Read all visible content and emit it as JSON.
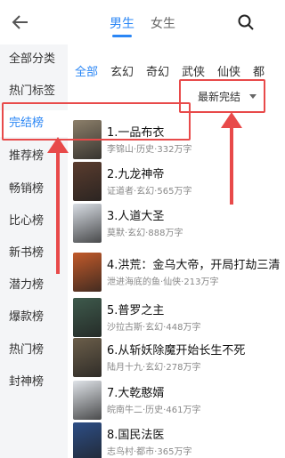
{
  "tabs": {
    "male": "男生",
    "female": "女生"
  },
  "sidebar": {
    "items": [
      {
        "label": "全部分类"
      },
      {
        "label": "热门标签"
      },
      {
        "label": "完结榜"
      },
      {
        "label": "推荐榜"
      },
      {
        "label": "畅销榜"
      },
      {
        "label": "比心榜"
      },
      {
        "label": "新书榜"
      },
      {
        "label": "潜力榜"
      },
      {
        "label": "爆款榜"
      },
      {
        "label": "热门榜"
      },
      {
        "label": "封神榜"
      }
    ]
  },
  "filters": {
    "items": [
      {
        "label": "全部"
      },
      {
        "label": "玄幻"
      },
      {
        "label": "奇幻"
      },
      {
        "label": "武侠"
      },
      {
        "label": "仙侠"
      },
      {
        "label": "都"
      }
    ]
  },
  "sort": {
    "label": "最新完结"
  },
  "books": [
    {
      "title": "1.一品布衣",
      "meta": "李锦山·历史·332万字",
      "cover": "#8c7f6a"
    },
    {
      "title": "2.九龙神帝",
      "meta": "证道者·玄幻·565万字",
      "cover": "#5a3c2e"
    },
    {
      "title": "3.人道大圣",
      "meta": "莫默·玄幻·888万字",
      "cover": "#d8dde4"
    },
    {
      "title": "4.洪荒：金乌大帝，开局打劫三清",
      "meta": "泄进海底的鱼·仙侠·213万字",
      "cover": "#c25a2a"
    },
    {
      "title": "5.普罗之主",
      "meta": "沙拉古斯·玄幻·448万字",
      "cover": "#3e5a4c"
    },
    {
      "title": "6.从斩妖除魔开始长生不死",
      "meta": "陆月十九·玄幻·278万字",
      "cover": "#6b5e4a"
    },
    {
      "title": "7.大乾憨婿",
      "meta": "皖南牛二·历史·461万字",
      "cover": "#dfe3e8"
    },
    {
      "title": "8.国民法医",
      "meta": "志鸟村·都市·365万字",
      "cover": "#2d4e86"
    }
  ],
  "colors": {
    "accent": "#2a86f5",
    "highlight": "#e84a4a"
  }
}
